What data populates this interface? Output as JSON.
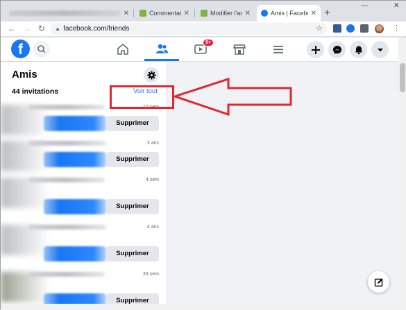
{
  "browser": {
    "tabs": [
      {
        "title": "",
        "blurred": true
      },
      {
        "title": "Commentaire",
        "favicon_color": "#7cb342"
      },
      {
        "title": "Modifier l'arti",
        "favicon_color": "#7cb342"
      },
      {
        "title": "Amis | Facebo",
        "favicon_color": "#1877f2",
        "active": true
      }
    ],
    "url": "facebook.com/friends",
    "window_controls": {
      "minimize": "—",
      "close": "✕"
    }
  },
  "fb_nav": {
    "logo": "f",
    "watch_badge": "9+"
  },
  "friends_panel": {
    "title": "Amis",
    "invitations_label": "44 invitations",
    "see_all_label": "Voir tout",
    "requests": [
      {
        "time": "17 sem",
        "delete_label": "Supprimer"
      },
      {
        "time": "3 ans",
        "delete_label": "Supprimer"
      },
      {
        "time": "4 sem",
        "delete_label": "Supprimer"
      },
      {
        "time": "4 ans",
        "delete_label": "Supprimer"
      },
      {
        "time": "33 sem",
        "delete_label": "Supprimer"
      }
    ]
  },
  "colors": {
    "facebook_blue": "#1877f2",
    "annotation_red": "#e3262b"
  }
}
